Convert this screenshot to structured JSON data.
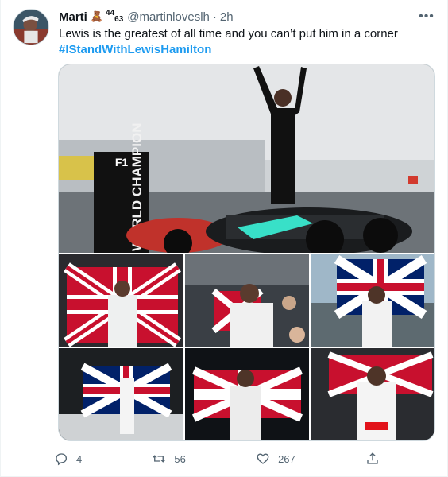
{
  "tweet": {
    "name": "Marti",
    "name_emoji": "🧸",
    "name_super": "44",
    "name_sub": "63",
    "handle": "@martinloveslh",
    "dot": "·",
    "time": "2h",
    "text": "Lewis is the greatest of all time and you can’t put him in a corner",
    "hashtag": "#IStandWithLewisHamilton"
  },
  "media": {
    "banner_text": "WORLD CHAMPION",
    "car_logo": "F1"
  },
  "actions": {
    "reply_count": "4",
    "retweet_count": "56",
    "like_count": "267"
  },
  "colors": {
    "link": "#1d9bf0",
    "muted": "#536471",
    "text": "#0f1419"
  }
}
